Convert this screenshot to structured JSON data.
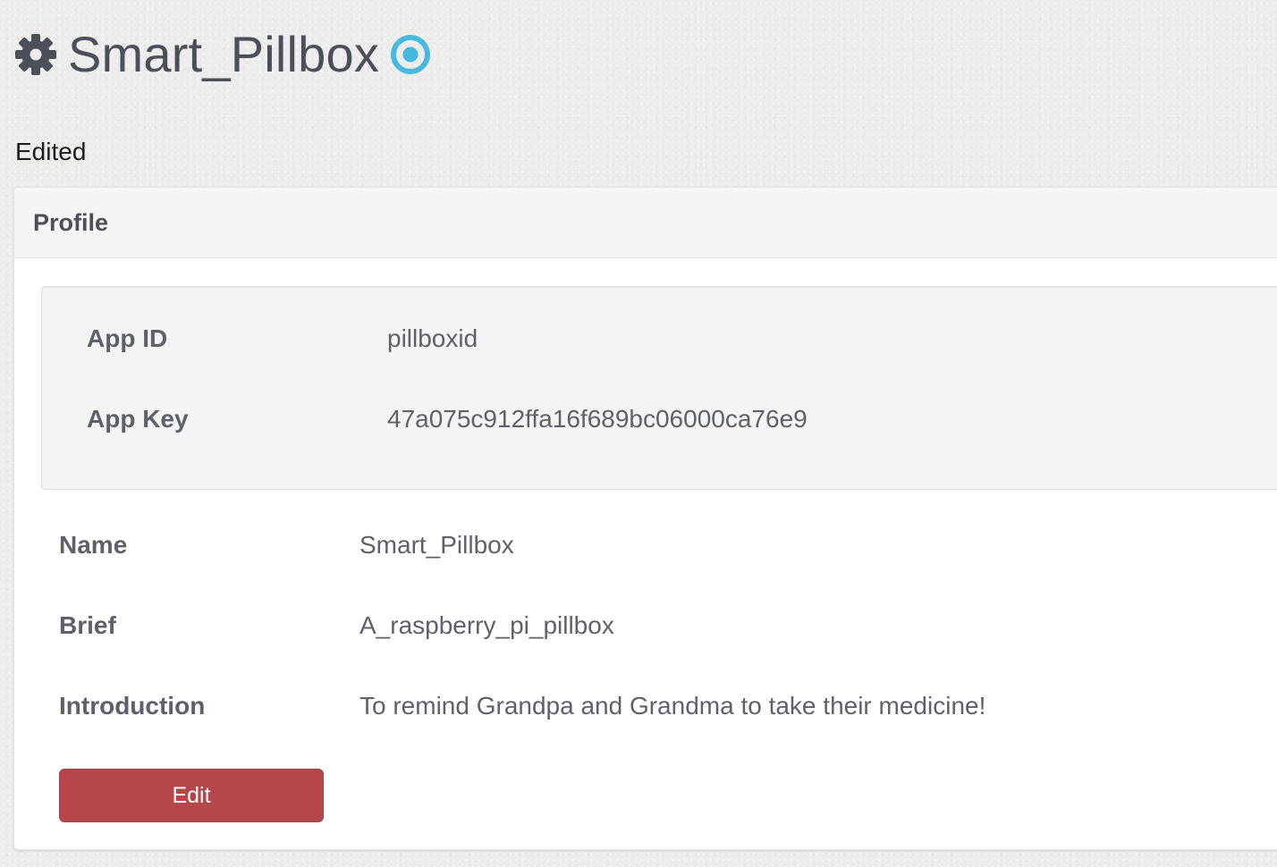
{
  "header": {
    "title": "Smart_Pillbox",
    "icon": "gear-icon",
    "status_icon": "target-circle-icon",
    "status_color": "#47b8e0"
  },
  "notice": {
    "text": "Edited"
  },
  "profile": {
    "heading": "Profile",
    "credentials": [
      {
        "label": "App ID",
        "value": "pillboxid"
      },
      {
        "label": "App Key",
        "value": "47a075c912ffa16f689bc06000ca76e9"
      }
    ],
    "fields": [
      {
        "label": "Name",
        "value": "Smart_Pillbox"
      },
      {
        "label": "Brief",
        "value": "A_raspberry_pi_pillbox"
      },
      {
        "label": "Introduction",
        "value": "To remind Grandpa and Grandma to take their medicine!"
      }
    ],
    "edit_label": "Edit",
    "edit_color": "#b5474a"
  }
}
